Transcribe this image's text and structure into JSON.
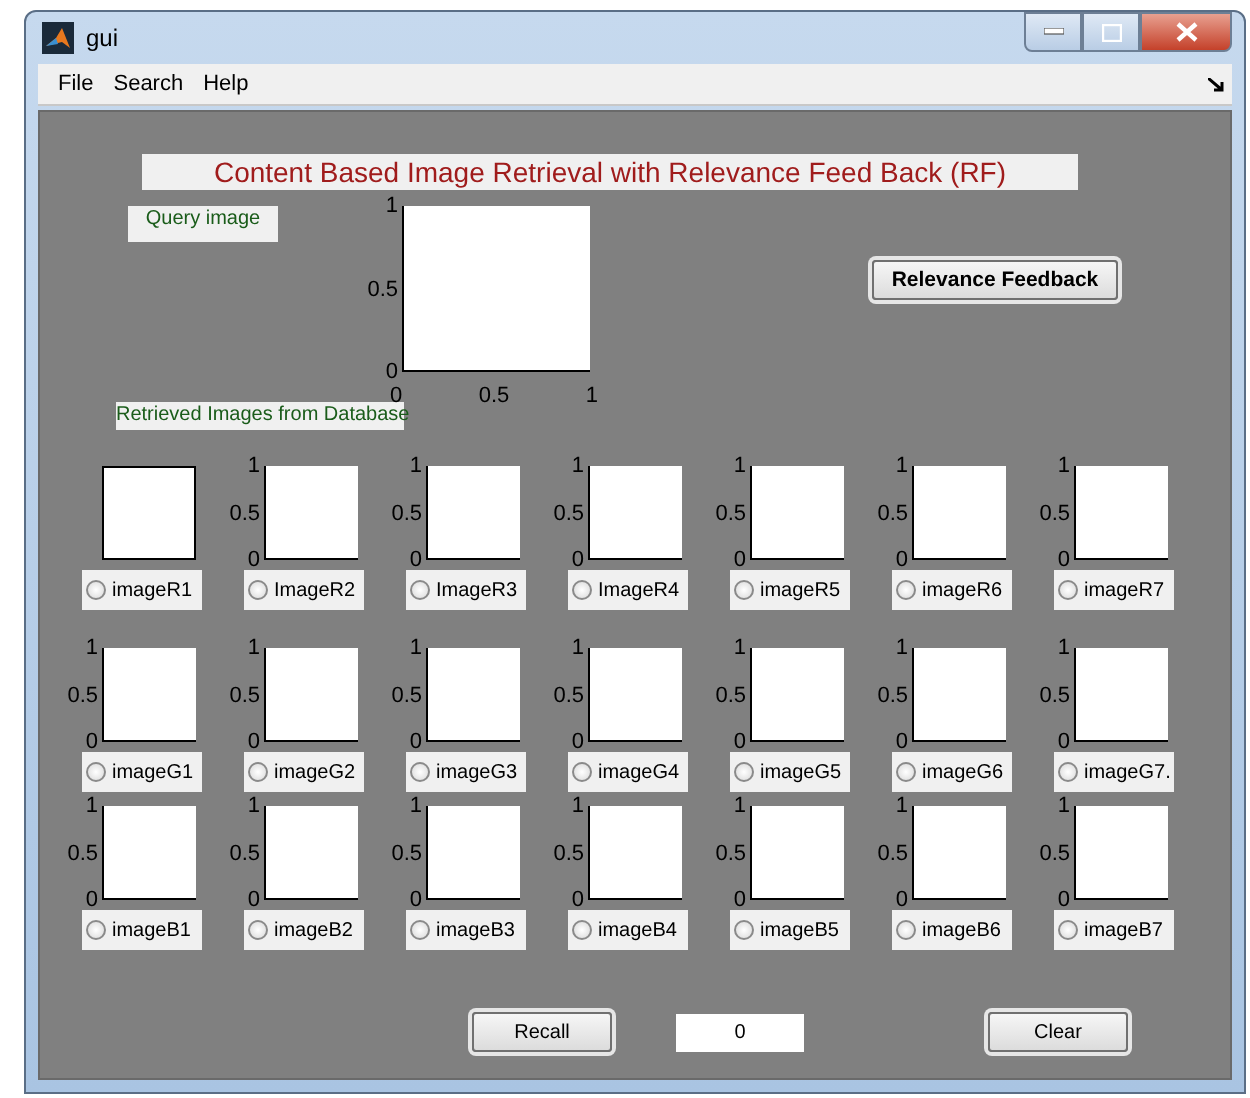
{
  "window": {
    "title": "gui"
  },
  "menu": [
    "File",
    "Search",
    "Help"
  ],
  "banner": "Content Based Image Retrieval with Relevance Feed Back (RF)",
  "query": {
    "label": "Query image",
    "yticks": [
      "1",
      "0.5",
      "0"
    ],
    "xticks": [
      "0",
      "0.5",
      "1"
    ]
  },
  "relevance_button": "Relevance Feedback",
  "retrieved_label": "Retrieved Images from Database",
  "results": [
    {
      "cells": [
        {
          "label": "imageR1",
          "selected": false
        },
        {
          "label": "ImageR2",
          "selected": false,
          "yticks": [
            "1",
            "0.5",
            "0"
          ]
        },
        {
          "label": "ImageR3",
          "selected": false,
          "yticks": [
            "1",
            "0.5",
            "0"
          ]
        },
        {
          "label": "ImageR4",
          "selected": false,
          "yticks": [
            "1",
            "0.5",
            "0"
          ]
        },
        {
          "label": "imageR5",
          "selected": false,
          "yticks": [
            "1",
            "0.5",
            "0"
          ]
        },
        {
          "label": "imageR6",
          "selected": false,
          "yticks": [
            "1",
            "0.5",
            "0"
          ]
        },
        {
          "label": "imageR7",
          "selected": false,
          "yticks": [
            "1",
            "0.5",
            "0"
          ]
        }
      ]
    },
    {
      "cells": [
        {
          "label": "imageG1",
          "selected": false,
          "yticks": [
            "1",
            "0.5",
            "0"
          ]
        },
        {
          "label": "imageG2",
          "selected": false,
          "yticks": [
            "1",
            "0.5",
            "0"
          ]
        },
        {
          "label": "imageG3",
          "selected": false,
          "yticks": [
            "1",
            "0.5",
            "0"
          ]
        },
        {
          "label": "imageG4",
          "selected": false,
          "yticks": [
            "1",
            "0.5",
            "0"
          ]
        },
        {
          "label": "imageG5",
          "selected": false,
          "yticks": [
            "1",
            "0.5",
            "0"
          ]
        },
        {
          "label": "imageG6",
          "selected": false,
          "yticks": [
            "1",
            "0.5",
            "0"
          ]
        },
        {
          "label": "imageG7.",
          "selected": false,
          "yticks": [
            "1",
            "0.5",
            "0"
          ]
        }
      ]
    },
    {
      "cells": [
        {
          "label": "imageB1",
          "selected": false,
          "yticks": [
            "1",
            "0.5",
            "0"
          ]
        },
        {
          "label": "imageB2",
          "selected": false,
          "yticks": [
            "1",
            "0.5",
            "0"
          ]
        },
        {
          "label": "imageB3",
          "selected": false,
          "yticks": [
            "1",
            "0.5",
            "0"
          ]
        },
        {
          "label": "imageB4",
          "selected": false,
          "yticks": [
            "1",
            "0.5",
            "0"
          ]
        },
        {
          "label": "imageB5",
          "selected": false,
          "yticks": [
            "1",
            "0.5",
            "0"
          ]
        },
        {
          "label": "imageB6",
          "selected": false,
          "yticks": [
            "1",
            "0.5",
            "0"
          ]
        },
        {
          "label": "imageB7",
          "selected": false,
          "yticks": [
            "1",
            "0.5",
            "0"
          ]
        }
      ]
    }
  ],
  "recall_button": "Recall",
  "count_field": {
    "value": "0"
  },
  "clear_button": "Clear"
}
